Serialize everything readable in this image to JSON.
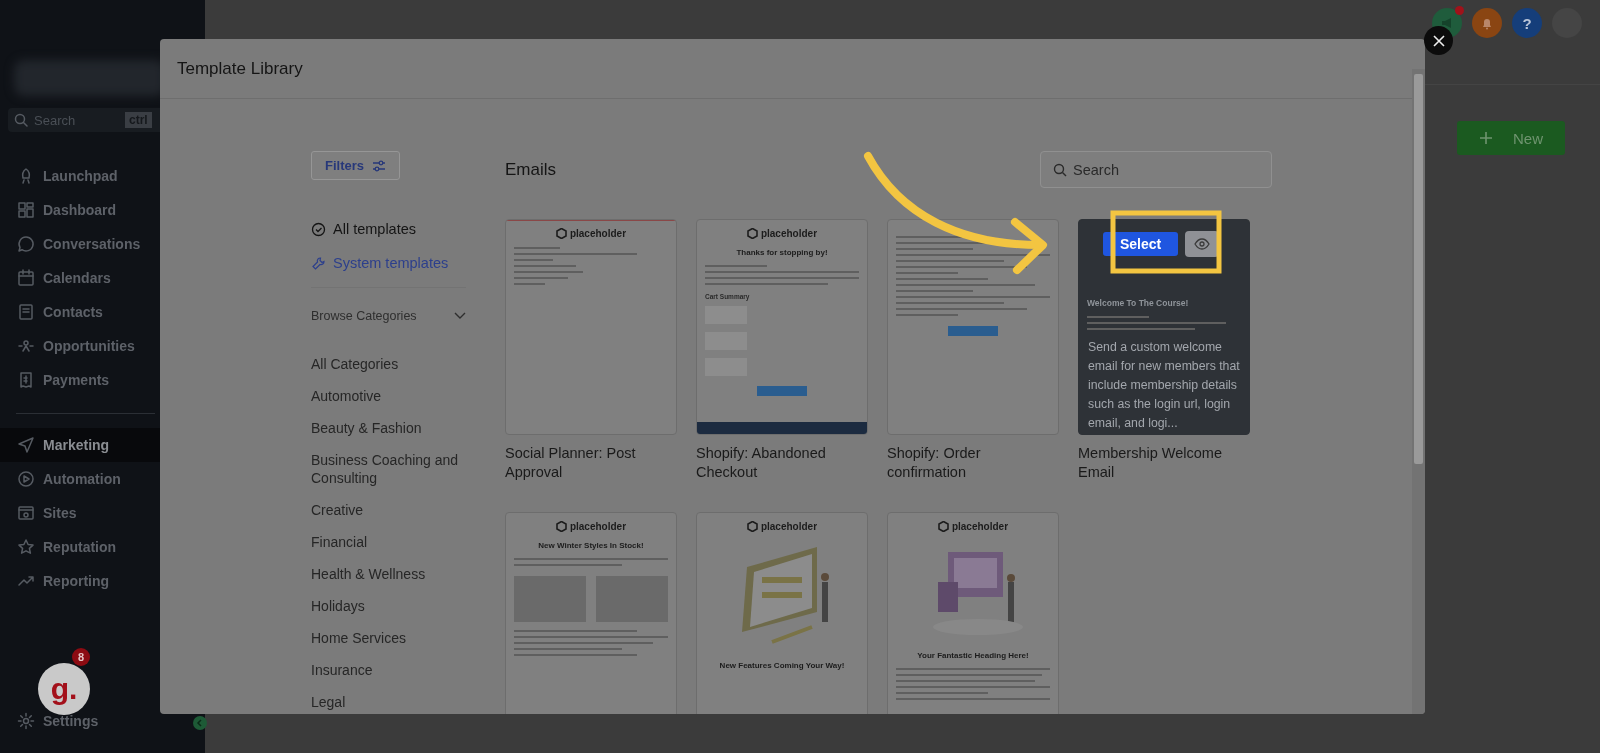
{
  "sidebar": {
    "search": {
      "placeholder": "Search",
      "shortcut": "ctrl"
    },
    "items": [
      {
        "label": "Launchpad",
        "selected": false
      },
      {
        "label": "Dashboard",
        "selected": false
      },
      {
        "label": "Conversations",
        "selected": false
      },
      {
        "label": "Calendars",
        "selected": false
      },
      {
        "label": "Contacts",
        "selected": false
      },
      {
        "label": "Opportunities",
        "selected": false
      },
      {
        "label": "Payments",
        "selected": false
      },
      {
        "label": "Marketing",
        "selected": true
      },
      {
        "label": "Automation",
        "selected": false
      },
      {
        "label": "Sites",
        "selected": false
      },
      {
        "label": "Reputation",
        "selected": false
      },
      {
        "label": "Reporting",
        "selected": false
      }
    ],
    "settings": "Settings",
    "chat": {
      "letter": "g.",
      "badge": "8"
    }
  },
  "header": {
    "new_button": "New",
    "help": "?"
  },
  "modal": {
    "title": "Template Library",
    "filters_button": "Filters",
    "scopes": [
      {
        "label": "All templates",
        "selected": false
      },
      {
        "label": "System templates",
        "selected": true
      }
    ],
    "browse": {
      "label": "Browse Categories",
      "expanded": true
    },
    "categories": [
      "All Categories",
      "Automotive",
      "Beauty & Fashion",
      "Business Coaching and Consulting",
      "Creative",
      "Financial",
      "Health & Wellness",
      "Holidays",
      "Home Services",
      "Insurance",
      "Legal"
    ],
    "section_title": "Emails",
    "search": {
      "placeholder": "Search"
    },
    "templates": [
      {
        "title": "Social Planner: Post Approval",
        "hovered": false,
        "preview": {
          "kind": "letter",
          "logo": "placeholder"
        }
      },
      {
        "title": "Shopify: Abandoned Checkout",
        "hovered": false,
        "preview": {
          "kind": "cart",
          "logo": "placeholder",
          "heading": "Thanks for stopping by!",
          "subheading": "Cart Summary"
        }
      },
      {
        "title": "Shopify: Order confirmation",
        "hovered": false,
        "preview": {
          "kind": "order"
        }
      },
      {
        "title": "Membership Welcome Email",
        "hovered": true,
        "description": "Send a custom welcome email for new members that include membership details such as the login url, login email, and logi...",
        "select_button": "Select",
        "preview": {
          "kind": "course",
          "heading": "Welcome To The Course!"
        }
      },
      {
        "hovered": false,
        "preview": {
          "kind": "products",
          "logo": "placeholder",
          "heading": "New Winter Styles In Stock!"
        }
      },
      {
        "hovered": false,
        "preview": {
          "kind": "illustration",
          "logo": "placeholder",
          "heading": "New Features Coming Your Way!"
        }
      },
      {
        "hovered": false,
        "preview": {
          "kind": "device",
          "logo": "placeholder",
          "heading": "Your Fantastic Heading Here!"
        }
      }
    ]
  }
}
